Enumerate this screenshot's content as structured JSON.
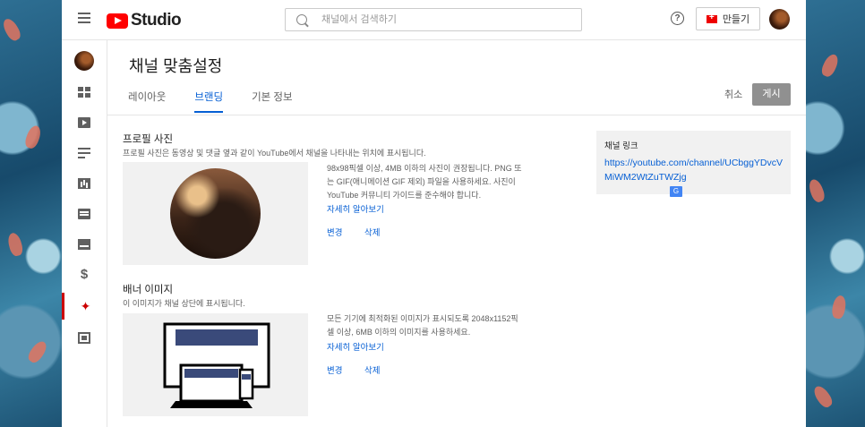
{
  "app": {
    "logo_text": "Studio"
  },
  "search": {
    "placeholder": "채널에서 검색하기"
  },
  "header": {
    "help_icon": "?",
    "create_label": "만들기"
  },
  "page": {
    "title": "채널 맞춤설정"
  },
  "tabs": [
    {
      "label": "레이아웃",
      "active": false
    },
    {
      "label": "브랜딩",
      "active": true
    },
    {
      "label": "기본 정보",
      "active": false
    }
  ],
  "actions": {
    "cancel": "취소",
    "publish": "게시"
  },
  "sidebar": {
    "items": [
      "dashboard-icon",
      "content-icon",
      "playlists-icon",
      "analytics-icon",
      "comments-icon",
      "subtitles-icon",
      "monetization-icon",
      "customization-icon",
      "audio-library-icon"
    ],
    "active": "customization-icon"
  },
  "profile": {
    "title": "프로필 사진",
    "description": "프로필 사진은 동영상 및 댓글 옆과 같이 YouTube에서 채널을 나타내는 위치에 표시됩니다.",
    "guide_lines": [
      "98x98픽셀 이상, 4MB 이하의 사진이 권장됩니다. PNG 또",
      "는 GIF(애니메이션 GIF 제외) 파일을 사용하세요. 사진이",
      "YouTube 커뮤니티 가이드를 준수해야 합니다."
    ],
    "learn_more": "자세히 알아보기",
    "change": "변경",
    "delete": "삭제"
  },
  "banner": {
    "title": "배너 이미지",
    "description": "이 이미지가 채널 상단에 표시됩니다.",
    "guide_lines": [
      "모든 기기에 최적화된 이미지가 표시되도록 2048x1152픽",
      "셀 이상, 6MB 이하의 이미지를 사용하세요."
    ],
    "learn_more": "자세히 알아보기",
    "change": "변경",
    "delete": "삭제"
  },
  "channel_link": {
    "label": "채널 링크",
    "url": "https://youtube.com/channel/UCbggYDvcVMiWM2WtZuTWZjg"
  },
  "colors": {
    "accent": "#065fd4",
    "brand": "#ff0000",
    "active_nav": "#cc0000"
  }
}
